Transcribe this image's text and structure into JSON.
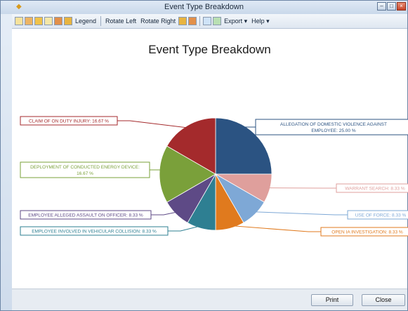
{
  "window": {
    "title": "Event Type Breakdown"
  },
  "toolbar": {
    "legend_label": "Legend",
    "rotate_left_label": "Rotate Left",
    "rotate_right_label": "Rotate Right",
    "export_label": "Export ▾",
    "help_label": "Help ▾"
  },
  "footer": {
    "print_label": "Print",
    "close_label": "Close"
  },
  "colors": {
    "allegation": "#2b5382",
    "warrant": "#df9f9c",
    "use_of_force": "#7ea8d6",
    "open_ia": "#e07a1e",
    "vehicular": "#2e7f92",
    "assault": "#5e4a86",
    "energy": "#7aa03a",
    "injury": "#a42a2c"
  },
  "chart_data": {
    "type": "pie",
    "title": "Event Type Breakdown",
    "unit": "%",
    "slices": [
      {
        "label": "ALLEGATION OF DOMESTIC VIOLENCE AGAINST EMPLOYEE",
        "value": 25.0,
        "color": "#2b5382",
        "text": "ALLEGATION OF DOMESTIC VIOLENCE AGAINST EMPLOYEE: 25.00 %"
      },
      {
        "label": "WARRANT SEARCH",
        "value": 8.33,
        "color": "#df9f9c",
        "text": "WARRANT SEARCH: 8.33 %"
      },
      {
        "label": "USE OF FORCE",
        "value": 8.33,
        "color": "#7ea8d6",
        "text": "USE OF FORCE: 8.33 %"
      },
      {
        "label": "OPEN IA INVESTIGATION",
        "value": 8.33,
        "color": "#e07a1e",
        "text": "OPEN IA INVESTIGATION: 8.33 %"
      },
      {
        "label": "EMPLOYEE INVOLVED IN VEHICULAR COLLISION",
        "value": 8.33,
        "color": "#2e7f92",
        "text": "EMPLOYEE INVOLVED IN VEHICULAR COLLISION: 8.33 %"
      },
      {
        "label": "EMPLOYEE ALLEGED ASSAULT ON OFFICER",
        "value": 8.33,
        "color": "#5e4a86",
        "text": "EMPLOYEE ALLEGED ASSAULT ON OFFICER: 8.33 %"
      },
      {
        "label": "DEPLOYMENT OF CONDUCTED ENERGY DEVICE",
        "value": 16.67,
        "color": "#7aa03a",
        "text": "DEPLOYMENT OF CONDUCTED ENERGY DEVICE: 16.67 %"
      },
      {
        "label": "CLAIM OF ON DUTY INJURY",
        "value": 16.67,
        "color": "#a42a2c",
        "text": "CLAIM OF ON DUTY INJURY: 16.67 %"
      }
    ]
  }
}
